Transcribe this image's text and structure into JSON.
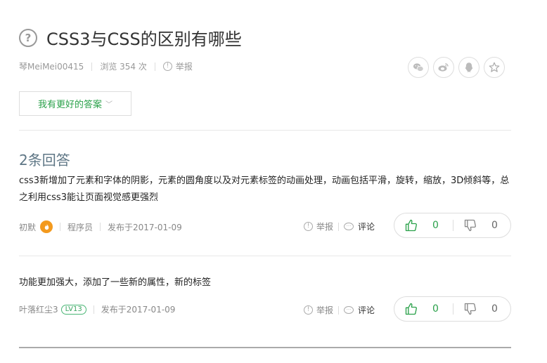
{
  "question": {
    "icon": "question-circle-icon",
    "title": "CSS3与CSS的区别有哪些",
    "author": "琴MeiMei00415",
    "views": "浏览 354 次",
    "report": "举报"
  },
  "share": {
    "items": [
      "wechat-icon",
      "weibo-icon",
      "qq-icon",
      "star-icon"
    ]
  },
  "better_answer_button": "我有更好的答案",
  "answers_count": "2条回答",
  "answers": [
    {
      "text": "css3新增加了元素和字体的阴影，元素的圆角度以及对元素标签的动画处理，动画包括平滑，旋转，缩放，3D倾斜等，总之利用css3能让页面视觉感更强烈",
      "author": "初默",
      "role": "程序员",
      "date": "发布于2017-01-09",
      "report": "举报",
      "comment": "评论",
      "upvotes": "0",
      "downvotes": "0"
    },
    {
      "text": "功能更加强大，添加了一些新的属性，新的标签",
      "author": "叶落红尘3",
      "level": "LV13",
      "date": "发布于2017-01-09",
      "report": "举报",
      "comment": "评论",
      "upvotes": "0",
      "downvotes": "0"
    }
  ],
  "colors": {
    "accent_green": "#2aa14a",
    "muted_text": "#999999",
    "count_blue_grey": "#5e7685",
    "fire_badge": "#f39a1e"
  }
}
